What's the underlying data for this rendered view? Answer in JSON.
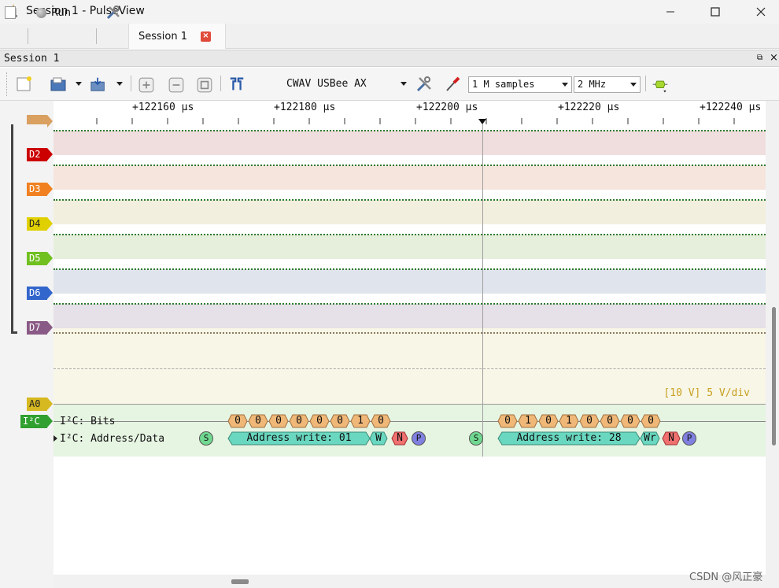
{
  "window": {
    "title": "Session 1 - PulseView",
    "min": "—",
    "max": "☐",
    "close": "✕"
  },
  "tabs": {
    "run_label": "Run",
    "session_tab": "Session 1",
    "session_close": "×"
  },
  "dock": {
    "title": "Session 1",
    "float": "⧉",
    "close": "×"
  },
  "toolbar": {
    "device": "CWAV USBee AX",
    "samples": "1 M samples",
    "samplerate": "2 MHz"
  },
  "ruler": {
    "ticks": [
      "+122160 µs",
      "+122180 µs",
      "+122200 µs",
      "+122220 µs",
      "+122240 µs"
    ]
  },
  "channels": {
    "d1": "",
    "d2": "D2",
    "d3": "D3",
    "d4": "D4",
    "d5": "D5",
    "d6": "D6",
    "d7": "D7",
    "a0": "A0",
    "i2c": "I²C"
  },
  "analog": {
    "scale": "[10 V] 5 V/div"
  },
  "decoder": {
    "bits_label": "I²C: Bits",
    "addr_label": "I²C: Address/Data",
    "bits_frame1": [
      "0",
      "0",
      "0",
      "0",
      "0",
      "0",
      "1",
      "0"
    ],
    "bits_frame2": [
      "0",
      "1",
      "0",
      "1",
      "0",
      "0",
      "0",
      "0"
    ],
    "frame1": {
      "start": "S",
      "addr": "Address write: 01",
      "rw": "W",
      "ack": "N",
      "stop": "P"
    },
    "frame2": {
      "start": "S",
      "addr": "Address write: 28",
      "rw": "Wr",
      "ack": "N",
      "stop": "P"
    }
  },
  "colors": {
    "d1": "#d9a060",
    "d2": "#cc0000",
    "d3": "#f08020",
    "d4": "#e0d000",
    "d5": "#70c020",
    "d6": "#3366cc",
    "d7": "#8a5a86",
    "a0": "#d6b820",
    "i2c": "#30a030",
    "bits_fill": "#f0b878",
    "addr_fill": "#6ad8c0",
    "nack_fill": "#f07070",
    "stop_fill": "#8080e0",
    "start_fill": "#70d890"
  },
  "watermark": "CSDN @风正豪"
}
